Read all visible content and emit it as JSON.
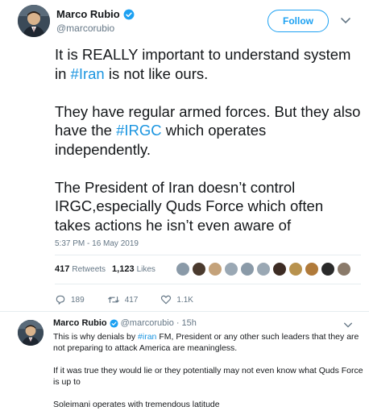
{
  "tweet": {
    "author": {
      "name": "Marco Rubio",
      "handle": "@marcorubio"
    },
    "follow_label": "Follow",
    "paragraphs": [
      [
        {
          "t": "It is REALLY important to understand system in ",
          "h": false
        },
        {
          "t": "#Iran",
          "h": true
        },
        {
          "t": " is not like ours.",
          "h": false
        }
      ],
      [
        {
          "t": "They have regular armed forces. But they also have the ",
          "h": false
        },
        {
          "t": "#IRGC",
          "h": true
        },
        {
          "t": " which operates independently.",
          "h": false
        }
      ],
      [
        {
          "t": "The President of Iran doesn’t control IRGC,especially Quds Force which often takes actions he isn’t even aware of",
          "h": false
        }
      ]
    ],
    "timestamp": "5:37 PM - 16 May 2019",
    "stats": {
      "retweets_count": "417",
      "retweets_label": "Retweets",
      "likes_count": "1,123",
      "likes_label": "Likes"
    },
    "liker_colors": [
      "#8a9aa8",
      "#4a3a2e",
      "#c4a27a",
      "#9aa8b4",
      "#8a9aa8",
      "#9aa8b4",
      "#3d2c24",
      "#b8924e",
      "#b07a3a",
      "#2a2a2a",
      "#8a7a6a"
    ],
    "actions": {
      "replies": "189",
      "retweets": "417",
      "likes": "1.1K"
    }
  },
  "reply": {
    "name": "Marco Rubio",
    "handle": "@marcorubio",
    "time": "· 15h",
    "paragraphs": [
      [
        {
          "t": "This is why denials by ",
          "h": false
        },
        {
          "t": "#iran",
          "h": true
        },
        {
          "t": " FM, President or any other such leaders that they are not preparing to attack America are meaningless.",
          "h": false
        }
      ],
      [
        {
          "t": "If it was true they would lie or they potentially may not even know what Quds Force is up to",
          "h": false
        }
      ],
      [
        {
          "t": "Soleimani operates with tremendous latitude",
          "h": false
        }
      ]
    ]
  },
  "colors": {
    "accent": "#1da1f2",
    "hashtag": "#1b95e0",
    "muted": "#657786",
    "text": "#14171a",
    "divider": "#e6ecf0"
  }
}
